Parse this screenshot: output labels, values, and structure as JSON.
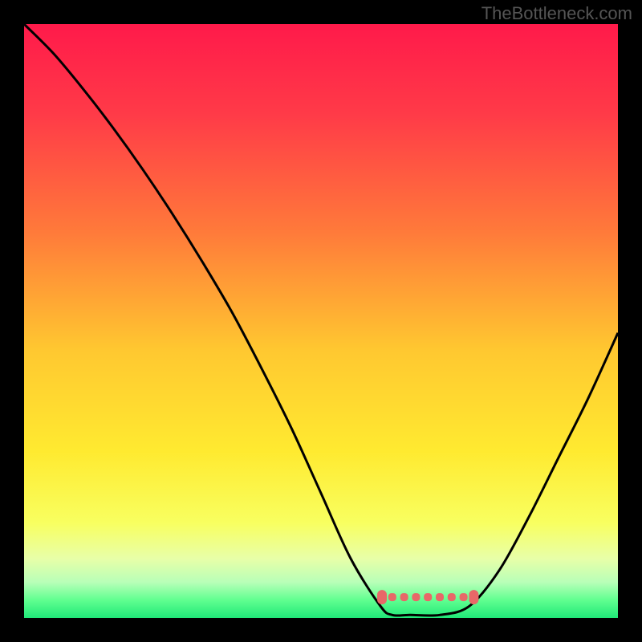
{
  "watermark": "TheBottleneck.com",
  "chart_data": {
    "type": "line",
    "title": "",
    "xlabel": "",
    "ylabel": "",
    "xlim": [
      0,
      100
    ],
    "ylim": [
      0,
      100
    ],
    "gradient_stops": [
      {
        "offset": 0.0,
        "color": "#ff1a4a"
      },
      {
        "offset": 0.15,
        "color": "#ff3a48"
      },
      {
        "offset": 0.35,
        "color": "#ff7a3a"
      },
      {
        "offset": 0.55,
        "color": "#ffc830"
      },
      {
        "offset": 0.72,
        "color": "#ffea30"
      },
      {
        "offset": 0.84,
        "color": "#f8ff60"
      },
      {
        "offset": 0.9,
        "color": "#e8ffa8"
      },
      {
        "offset": 0.94,
        "color": "#b8ffb8"
      },
      {
        "offset": 0.97,
        "color": "#60ff90"
      },
      {
        "offset": 1.0,
        "color": "#20e878"
      }
    ],
    "curve": {
      "description": "V-shaped bottleneck curve",
      "x": [
        0,
        5,
        10,
        15,
        20,
        25,
        30,
        35,
        40,
        45,
        50,
        55,
        60,
        62,
        65,
        70,
        75,
        80,
        85,
        90,
        95,
        100
      ],
      "y": [
        100,
        95,
        89,
        82.5,
        75.5,
        68,
        60,
        51.5,
        42,
        32,
        21,
        10,
        2,
        0.5,
        0.5,
        0.5,
        2,
        8,
        17,
        27,
        37,
        48
      ]
    },
    "optimal_zone": {
      "description": "Flat optimal region markers",
      "x_start": 60,
      "x_end": 76,
      "y": 3.5,
      "color": "#e86868"
    }
  }
}
